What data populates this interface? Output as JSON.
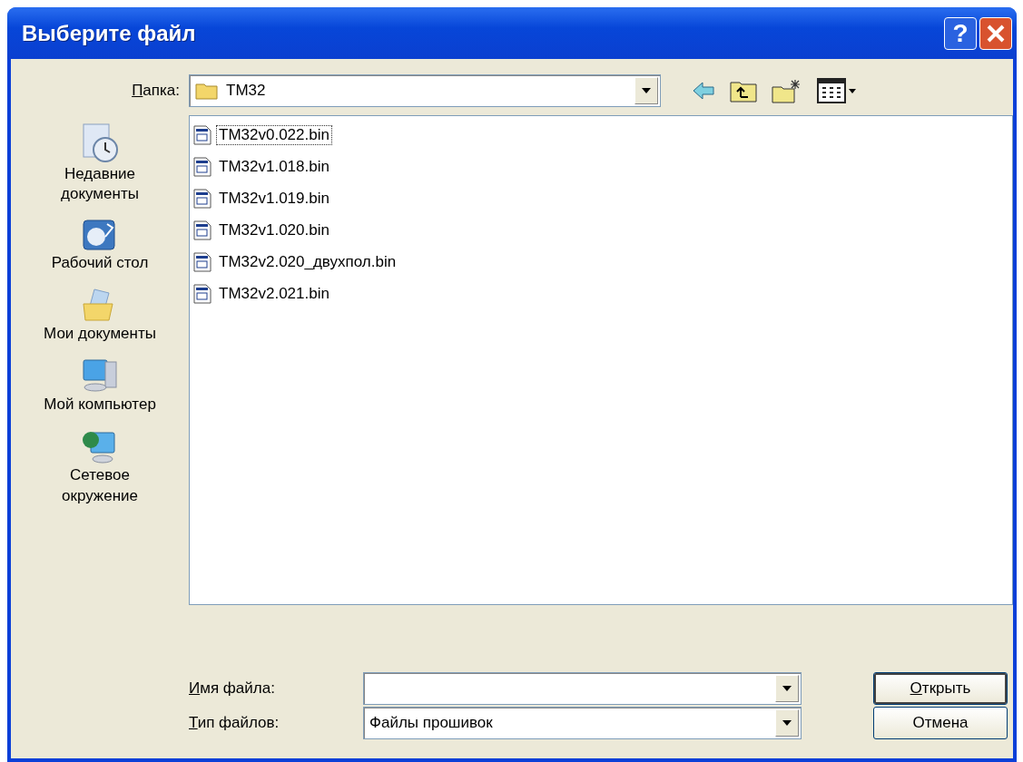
{
  "window": {
    "title": "Выберите файл",
    "help": "?"
  },
  "folder": {
    "label": "Папка:",
    "mnemonic": true,
    "value": "TM32"
  },
  "places": [
    {
      "kind": "recent",
      "label": "Недавние\nдокументы"
    },
    {
      "kind": "desktop",
      "label": "Рабочий стол"
    },
    {
      "kind": "documents",
      "label": "Мои документы"
    },
    {
      "kind": "computer",
      "label": "Мой компьютер"
    },
    {
      "kind": "network",
      "label": "Сетевое\nокружение"
    }
  ],
  "files": [
    {
      "name": "TM32v0.022.bin",
      "focused": true
    },
    {
      "name": "TM32v1.018.bin",
      "focused": false
    },
    {
      "name": "TM32v1.019.bin",
      "focused": false
    },
    {
      "name": "TM32v1.020.bin",
      "focused": false
    },
    {
      "name": "TM32v2.020_двухпол.bin",
      "focused": false
    },
    {
      "name": "TM32v2.021.bin",
      "focused": false
    }
  ],
  "file_name": {
    "label": "Имя файла:",
    "mnemonic": true
  },
  "file_type": {
    "label": "Тип файлов:",
    "mnemonic": true,
    "value": "Файлы прошивок"
  },
  "buttons": [
    {
      "label": "Открыть",
      "mnemonic": true,
      "default": true
    },
    {
      "label": "Отмена",
      "mnemonic": false,
      "default": false
    }
  ]
}
